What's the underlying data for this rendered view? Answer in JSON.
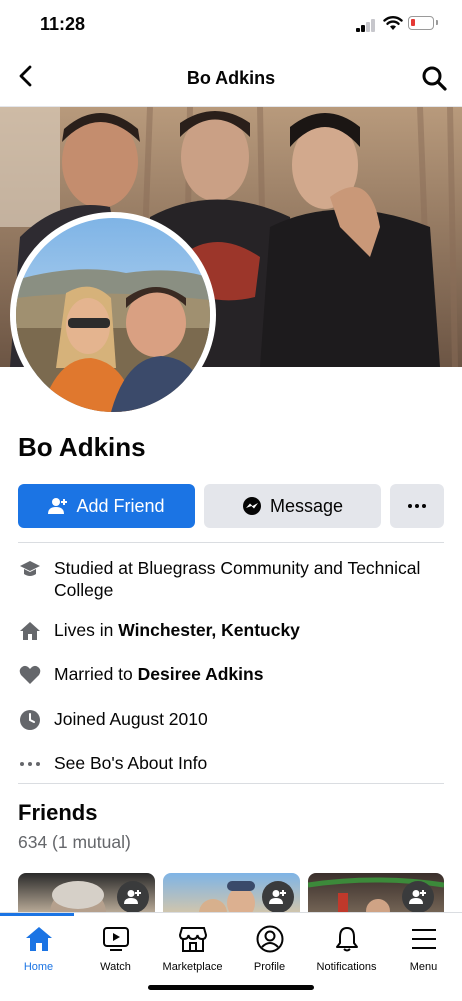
{
  "status": {
    "time": "11:28"
  },
  "header": {
    "title": "Bo Adkins"
  },
  "profile": {
    "name": "Bo Adkins",
    "add_friend_label": "Add Friend",
    "message_label": "Message"
  },
  "about": {
    "studied_prefix": "Studied at ",
    "studied_school": "Bluegrass Community and Technical College",
    "lives_prefix": "Lives in ",
    "lives_place": "Winchester, Kentucky",
    "married_prefix": "Married to ",
    "married_person": "Desiree Adkins",
    "joined": "Joined August 2010",
    "see_about": "See Bo's About Info"
  },
  "friends": {
    "title": "Friends",
    "count": "634 (1 mutual)"
  },
  "tabs": [
    {
      "label": "Home",
      "icon": "home-icon"
    },
    {
      "label": "Watch",
      "icon": "watch-icon"
    },
    {
      "label": "Marketplace",
      "icon": "marketplace-icon"
    },
    {
      "label": "Profile",
      "icon": "profile-icon"
    },
    {
      "label": "Notifications",
      "icon": "bell-icon"
    },
    {
      "label": "Menu",
      "icon": "menu-icon"
    }
  ],
  "colors": {
    "accent": "#1b74e4",
    "button_grey": "#e4e6eb",
    "secondary_text": "#65676b"
  }
}
